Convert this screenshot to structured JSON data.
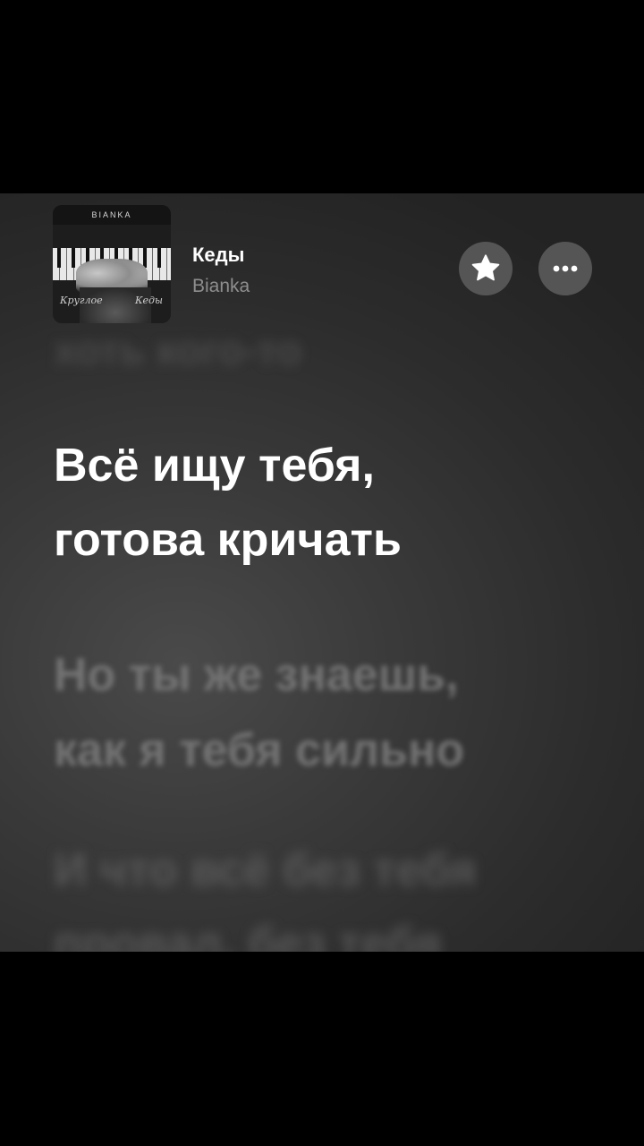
{
  "track": {
    "title": "Кеды",
    "artist": "Bianka",
    "cover_brand": "BIANKA",
    "cover_script_left": "Круглое",
    "cover_script_right": "Кеды"
  },
  "actions": {
    "favorite_icon": "star-icon",
    "more_icon": "ellipsis-icon"
  },
  "lyrics": {
    "previous": "хоть кого-то",
    "active": [
      "Всё ищу тебя,",
      "готова кричать"
    ],
    "next": [
      "Но ты же знаешь,",
      "как я тебя сильно"
    ],
    "after": [
      "И что всё без тебя",
      "провал, без тебя"
    ]
  },
  "colors": {
    "background": "#2c2c2c",
    "active_lyric": "#ffffff",
    "artist": "#8e8e8e",
    "button": "#555555"
  }
}
